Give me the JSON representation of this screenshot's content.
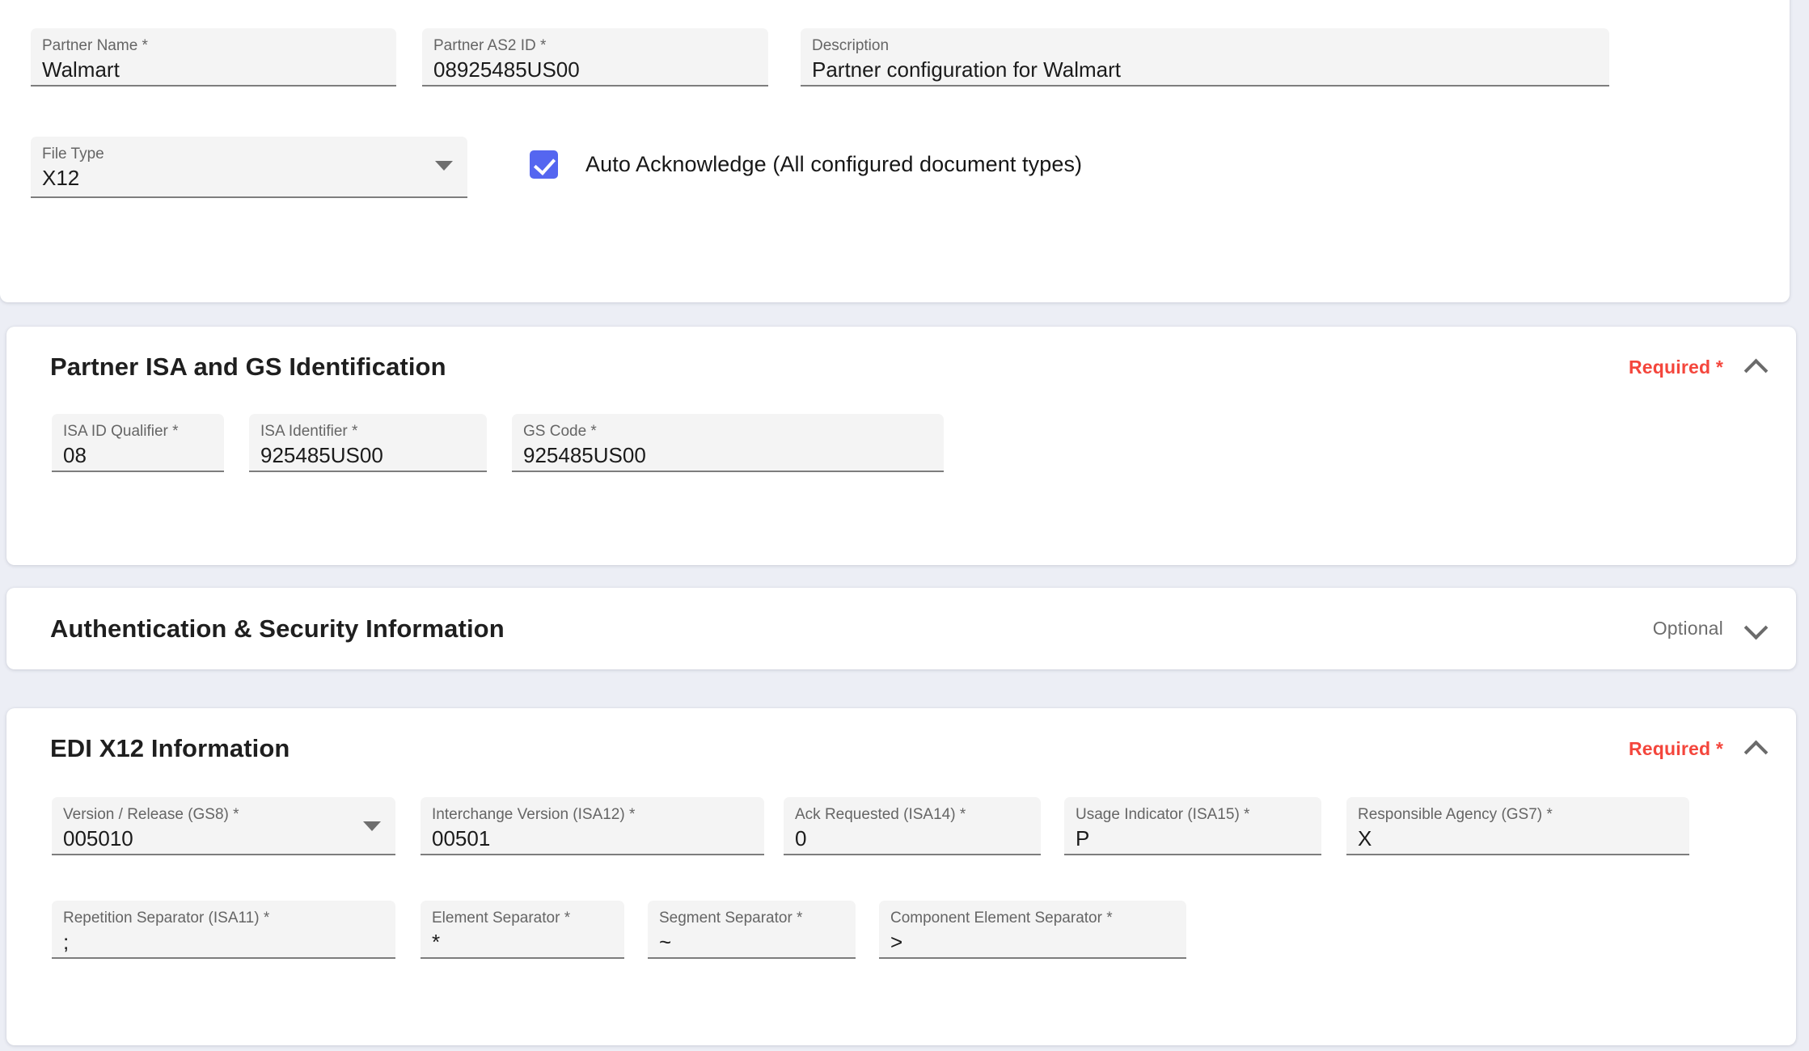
{
  "top_section": {
    "fields": [
      {
        "label": "Partner Name *",
        "value": "Walmart"
      },
      {
        "label": "Partner AS2 ID *",
        "value": "08925485US00"
      },
      {
        "label": "Description",
        "value": "Partner configuration for Walmart"
      },
      {
        "label": "File Type",
        "value": "X12"
      }
    ],
    "auto_acknowledge": {
      "label": "Auto Acknowledge (All configured document types)",
      "checked": true
    }
  },
  "isa_section": {
    "title": "Partner ISA and GS Identification",
    "status": "Required *",
    "expanded": true,
    "fields": [
      {
        "label": "ISA ID Qualifier *",
        "value": "08"
      },
      {
        "label": "ISA Identifier *",
        "value": "925485US00"
      },
      {
        "label": "GS Code *",
        "value": "925485US00"
      }
    ]
  },
  "auth_section": {
    "title": "Authentication & Security Information",
    "status": "Optional",
    "expanded": false
  },
  "edi_section": {
    "title": "EDI X12 Information",
    "status": "Required *",
    "expanded": true,
    "row1": [
      {
        "label": "Version / Release (GS8) *",
        "value": "005010"
      },
      {
        "label": "Interchange Version (ISA12) *",
        "value": "00501"
      },
      {
        "label": "Ack Requested (ISA14) *",
        "value": "0"
      },
      {
        "label": "Usage Indicator (ISA15) *",
        "value": "P"
      },
      {
        "label": "Responsible Agency (GS7) *",
        "value": "X"
      }
    ],
    "row2": [
      {
        "label": "Repetition Separator (ISA11) *",
        "value": ";"
      },
      {
        "label": "Element Separator *",
        "value": "*"
      },
      {
        "label": "Segment Separator *",
        "value": "~"
      },
      {
        "label": "Component Element Separator *",
        "value": ">"
      }
    ]
  },
  "colors": {
    "page_background": "#eceef5",
    "card_background": "#ffffff",
    "field_background": "#f4f4f4",
    "field_underline": "#7d7d7d",
    "required_red": "#f4463c",
    "optional_gray": "#6d6d6d",
    "checkbox_blue": "#5566f0",
    "label_gray": "#656565",
    "value_black": "#1b1b1b"
  }
}
